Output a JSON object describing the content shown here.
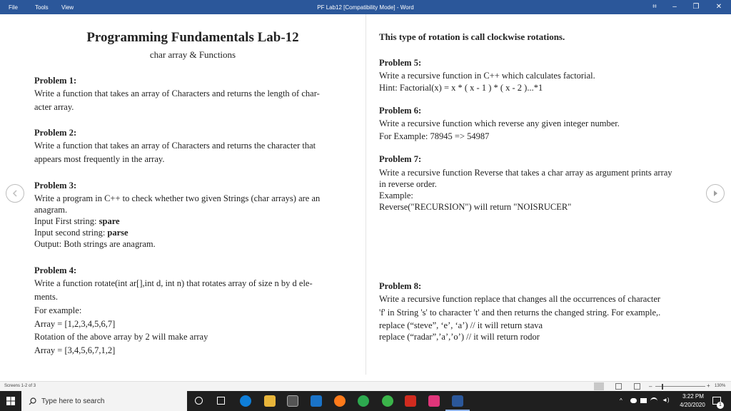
{
  "titlebar": {
    "menu": [
      "File",
      "Tools",
      "View"
    ],
    "title": "PF Lab12 [Compatibility Mode]  -  Word",
    "buttons": {
      "minimize": "–",
      "restore": "❐",
      "close": "✕"
    }
  },
  "left": {
    "title": "Programming Fundamentals Lab-12",
    "subtitle": "char array & Functions",
    "p1_head": "Problem 1:",
    "p1_l1": "Write a function that takes an array of Characters and returns the length of char-",
    "p1_l2": "acter array.",
    "p2_head": "Problem 2:",
    "p2_l1": "Write a function that takes an array of Characters and returns the character that",
    "p2_l2": "appears most frequently in the array.",
    "p3_head": "Problem 3:",
    "p3_l1": "Write a program in C++ to check whether two given Strings (char arrays) are an",
    "p3_l2": "anagram.",
    "p3_in1_label": "Input First string: ",
    "p3_in1_value": "spare",
    "p3_in2_label": "Input second string: ",
    "p3_in2_value": "parse",
    "p3_out": "Output: Both strings are anagram.",
    "p4_head": "Problem 4:",
    "p4_l1": "Write a function rotate(int ar[],int d, int n) that rotates array of size n by d ele-",
    "p4_l2": "ments.",
    "p4_l3": "For example:",
    "p4_l4": "Array = [1,2,3,4,5,6,7]",
    "p4_l5": "Rotation of the above array by 2 will make array",
    "p4_l6": "Array = [3,4,5,6,7,1,2]"
  },
  "right": {
    "top": "This type of rotation is call clockwise rotations.",
    "p5_head": "Problem 5:",
    "p5_l1": "Write a recursive function in C++ which calculates factorial.",
    "p5_l2": "Hint: Factorial(x) = x * ( x - 1 ) * ( x - 2 )...*1",
    "p6_head": "Problem 6:",
    "p6_l1": "Write a recursive function which reverse any given integer number.",
    "p6_l2": "For Example: 78945 => 54987",
    "p7_head": "Problem 7:",
    "p7_l1": "Write a recursive function Reverse that takes a char array as argument prints array",
    "p7_l2": "in reverse order.",
    "p7_l3": "Example:",
    "p7_l4": "Reverse(\"RECURSION\") will return \"NOISRUCER\"",
    "p8_head": "Problem 8:",
    "p8_l1": "Write a recursive function replace that changes all the occurrences of character",
    "p8_l2": "'f' in String 's' to character 't' and then returns the changed string. For example,.",
    "p8_l3": "replace (“steve”, ‘e’, ‘a’) // it will return stava",
    "p8_l4": "replace (“radar”,’a’,’o’) // it will return rodor"
  },
  "statusbar": {
    "screens": "Screens 1-2 of 3",
    "zoom": "130%"
  },
  "taskbar": {
    "search_placeholder": "Type here to search",
    "time": "3:22 PM",
    "date": "4/20/2020",
    "notif_count": "1"
  }
}
